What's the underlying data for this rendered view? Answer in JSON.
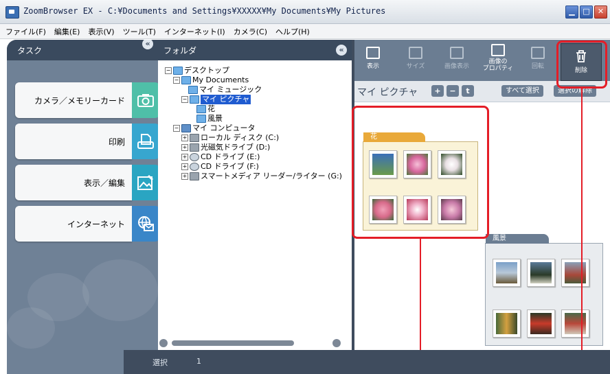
{
  "window": {
    "title": "ZoomBrowser EX  -  C:¥Documents and Settings¥XXXXX¥My Documents¥My Pictures"
  },
  "menu": [
    "ファイル(F)",
    "編集(E)",
    "表示(V)",
    "ツール(T)",
    "インターネット(I)",
    "カメラ(C)",
    "ヘルプ(H)"
  ],
  "task": {
    "title": "タスク",
    "buttons": [
      {
        "label": "カメラ／メモリーカード",
        "color": "#4fbfa8",
        "icon": "camera-icon"
      },
      {
        "label": "印刷",
        "color": "#37a6cf",
        "icon": "printer-icon"
      },
      {
        "label": "表示／編集",
        "color": "#2aa5c2",
        "icon": "image-edit-icon"
      },
      {
        "label": "インターネット",
        "color": "#3a86c8",
        "icon": "globe-mail-icon"
      }
    ]
  },
  "folder": {
    "title": "フォルダ",
    "tree": [
      {
        "label": "デスクトップ",
        "depth": 0,
        "kind": "desktop"
      },
      {
        "label": "My Documents",
        "depth": 1,
        "kind": "folder-open"
      },
      {
        "label": "マイ ミュージック",
        "depth": 2,
        "kind": "folder"
      },
      {
        "label": "マイ ピクチャ",
        "depth": 2,
        "kind": "folder-open",
        "selected": true
      },
      {
        "label": "花",
        "depth": 3,
        "kind": "folder"
      },
      {
        "label": "風景",
        "depth": 3,
        "kind": "folder"
      },
      {
        "label": "マイ コンピュータ",
        "depth": 1,
        "kind": "computer"
      },
      {
        "label": "ローカル ディスク (C:)",
        "depth": 2,
        "kind": "drive"
      },
      {
        "label": "光磁気ドライブ (D:)",
        "depth": 2,
        "kind": "drive"
      },
      {
        "label": "CD ドライブ (E:)",
        "depth": 2,
        "kind": "cd"
      },
      {
        "label": "CD ドライブ (F:)",
        "depth": 2,
        "kind": "cd"
      },
      {
        "label": "スマートメディア リーダー/ライター (G:)",
        "depth": 2,
        "kind": "drive"
      }
    ]
  },
  "browser": {
    "tools": [
      {
        "label": "表示",
        "enabled": true
      },
      {
        "label": "サイズ",
        "enabled": false
      },
      {
        "label": "画像表示",
        "enabled": false
      },
      {
        "label": "画像の\nプロパティ",
        "enabled": true
      },
      {
        "label": "回転",
        "enabled": false
      }
    ],
    "delete_label": "削除",
    "path": "マイ ピクチャ",
    "zoom_in": "+",
    "zoom_out": "−",
    "up": "t",
    "select_all": "すべて選択",
    "deselect": "選択の解除",
    "groups": [
      {
        "name": "花",
        "tab_color": "#e9a93a",
        "photos": [
          "#6a9a4a",
          "#d7669d",
          "#e9e0e4",
          "#d86a8a",
          "#f0b0c8",
          "#c87aa8"
        ]
      },
      {
        "name": "風景",
        "tab_color": "#6b7d92",
        "photos": [
          "#7aa0c8",
          "#5a7a98",
          "#8aa0b8",
          "#d4a040",
          "#c83a2a",
          "#b8483a"
        ]
      }
    ]
  },
  "status": {
    "label": "選択",
    "count": "1"
  },
  "colors": {
    "highlight": "#e41d27"
  }
}
